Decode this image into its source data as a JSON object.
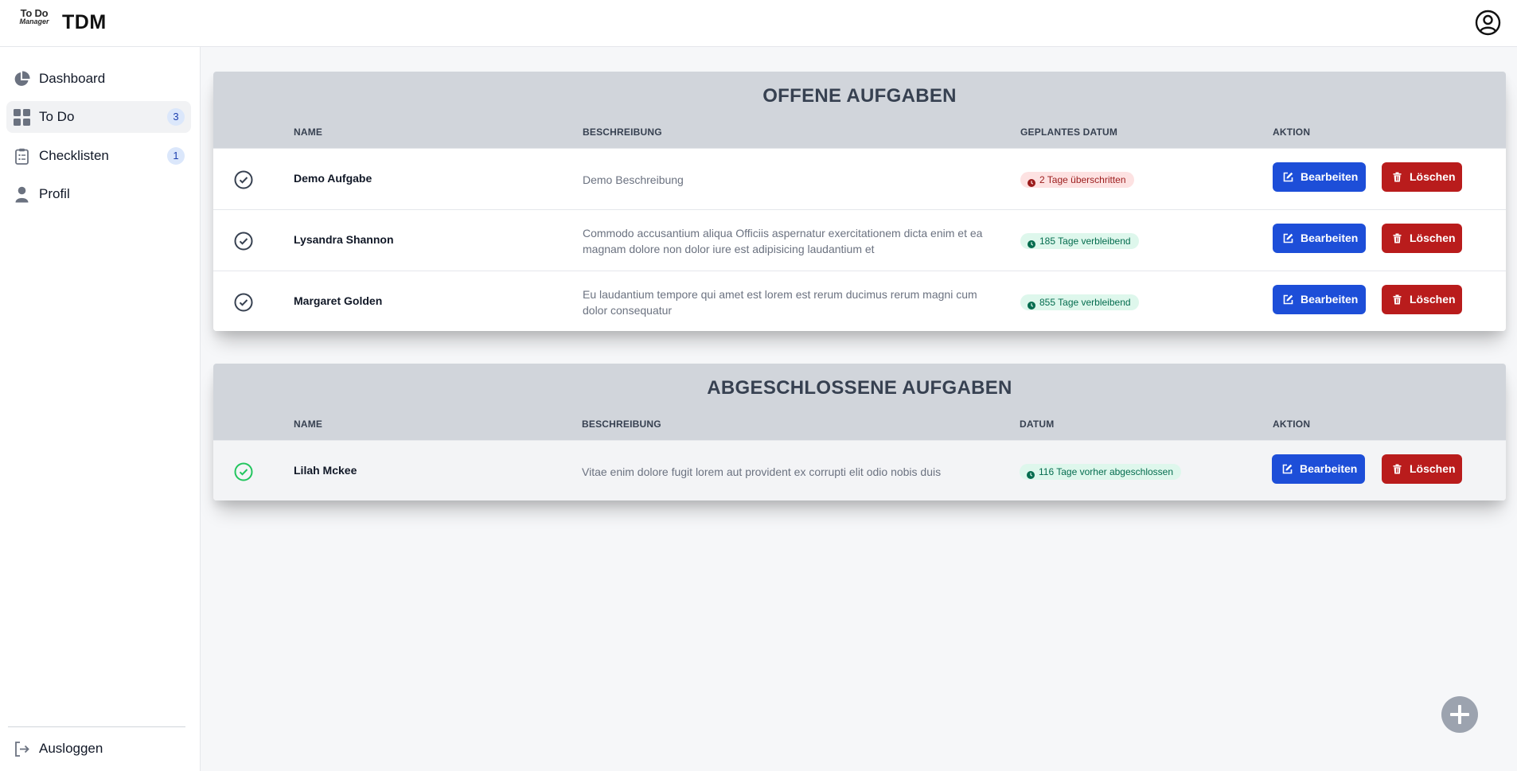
{
  "app": {
    "logo_line1": "To Do",
    "logo_line2": "Manager",
    "brand": "TDM"
  },
  "sidebar": {
    "items": [
      {
        "label": "Dashboard",
        "icon": "pie-chart-icon"
      },
      {
        "label": "To Do",
        "icon": "grid-icon",
        "count": "3"
      },
      {
        "label": "Checklisten",
        "icon": "clipboard-icon",
        "count": "1"
      },
      {
        "label": "Profil",
        "icon": "user-icon"
      }
    ],
    "logout": "Ausloggen"
  },
  "open_tasks": {
    "title": "OFFENE AUFGABEN",
    "columns": {
      "name": "NAME",
      "description": "BESCHREIBUNG",
      "date": "GEPLANTES DATUM",
      "action": "AKTION"
    },
    "rows": [
      {
        "name": "Demo Aufgabe",
        "description": "Demo Beschreibung",
        "status": "2 Tage überschritten",
        "status_color": "#9b1c1c"
      },
      {
        "name": "Lysandra Shannon",
        "description": "Commodo accusantium aliqua Officiis aspernatur exercitationem dicta enim et ea magnam dolore non dolor iure est adipisicing laudantium et",
        "status": "185 Tage verbleibend",
        "status_color": "#046c4e"
      },
      {
        "name": "Margaret Golden",
        "description": "Eu laudantium tempore qui amet est lorem est rerum ducimus rerum magni cum dolor consequatur",
        "status": "855 Tage verbleibend",
        "status_color": "#046c4e"
      }
    ]
  },
  "done_tasks": {
    "title": "ABGESCHLOSSENE AUFGABEN",
    "columns": {
      "name": "NAME",
      "description": "BESCHREIBUNG",
      "date": "DATUM",
      "action": "AKTION"
    },
    "rows": [
      {
        "name": "Lilah Mckee",
        "description": "Vitae enim dolore fugit lorem aut provident ex corrupti elit odio nobis duis",
        "status": "116 Tage vorher abgeschlossen",
        "status_color": "#046c4e"
      }
    ]
  },
  "actions": {
    "edit": "Bearbeiten",
    "delete": "Löschen"
  },
  "colors": {
    "edit": "#1d4ed8",
    "delete": "#b91c1c",
    "header": "#d1d5db",
    "done_check": "#22c55e"
  }
}
